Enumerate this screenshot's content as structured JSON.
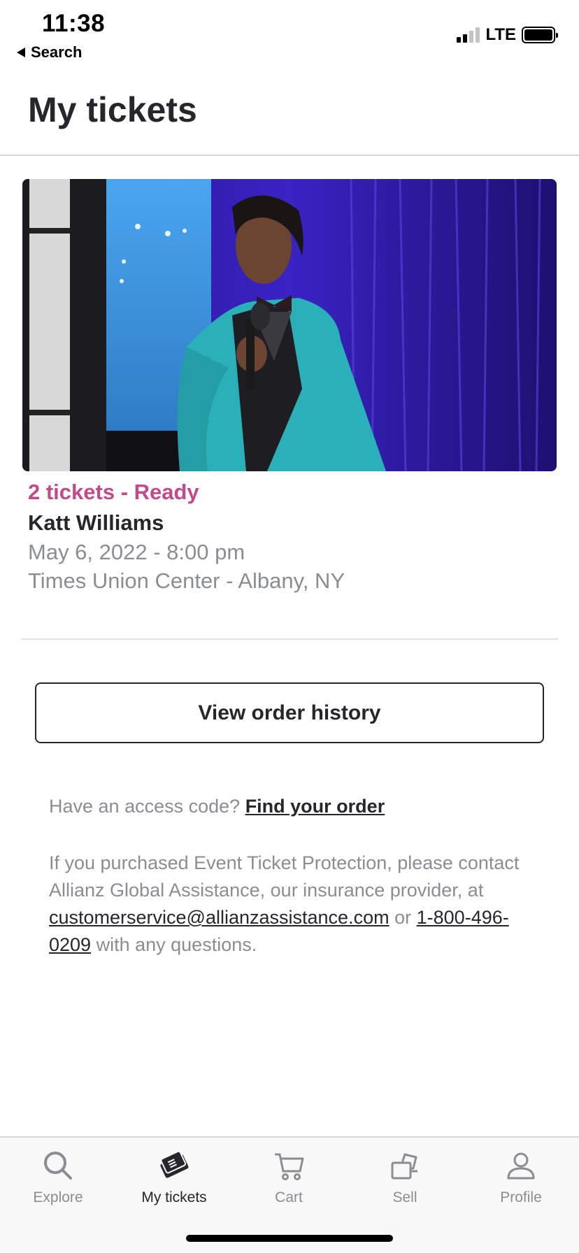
{
  "status_bar": {
    "time": "11:38",
    "back_label": "Search",
    "network": "LTE"
  },
  "header": {
    "title": "My tickets"
  },
  "event": {
    "status": "2 tickets - Ready",
    "status_color": "#c14b8a",
    "name": "Katt Williams",
    "date": "May 6, 2022 - 8:00 pm",
    "venue": "Times Union Center - Albany, NY"
  },
  "actions": {
    "order_history_label": "View order history"
  },
  "info": {
    "access_prefix": "Have an access code?",
    "access_link": "Find your order",
    "protection_text": "If you purchased Event Ticket Protection, please contact Allianz Global Assistance, our insurance provider, at",
    "email": "customerservice@allianzassistance.com",
    "or_text": "or",
    "phone": "1-800-496-0209",
    "suffix": "with any questions."
  },
  "tab_bar": {
    "tabs": [
      {
        "label": "Explore",
        "icon": "search-icon"
      },
      {
        "label": "My tickets",
        "icon": "ticket-icon",
        "active": true
      },
      {
        "label": "Cart",
        "icon": "cart-icon"
      },
      {
        "label": "Sell",
        "icon": "sell-icon"
      },
      {
        "label": "Profile",
        "icon": "profile-icon"
      }
    ]
  }
}
